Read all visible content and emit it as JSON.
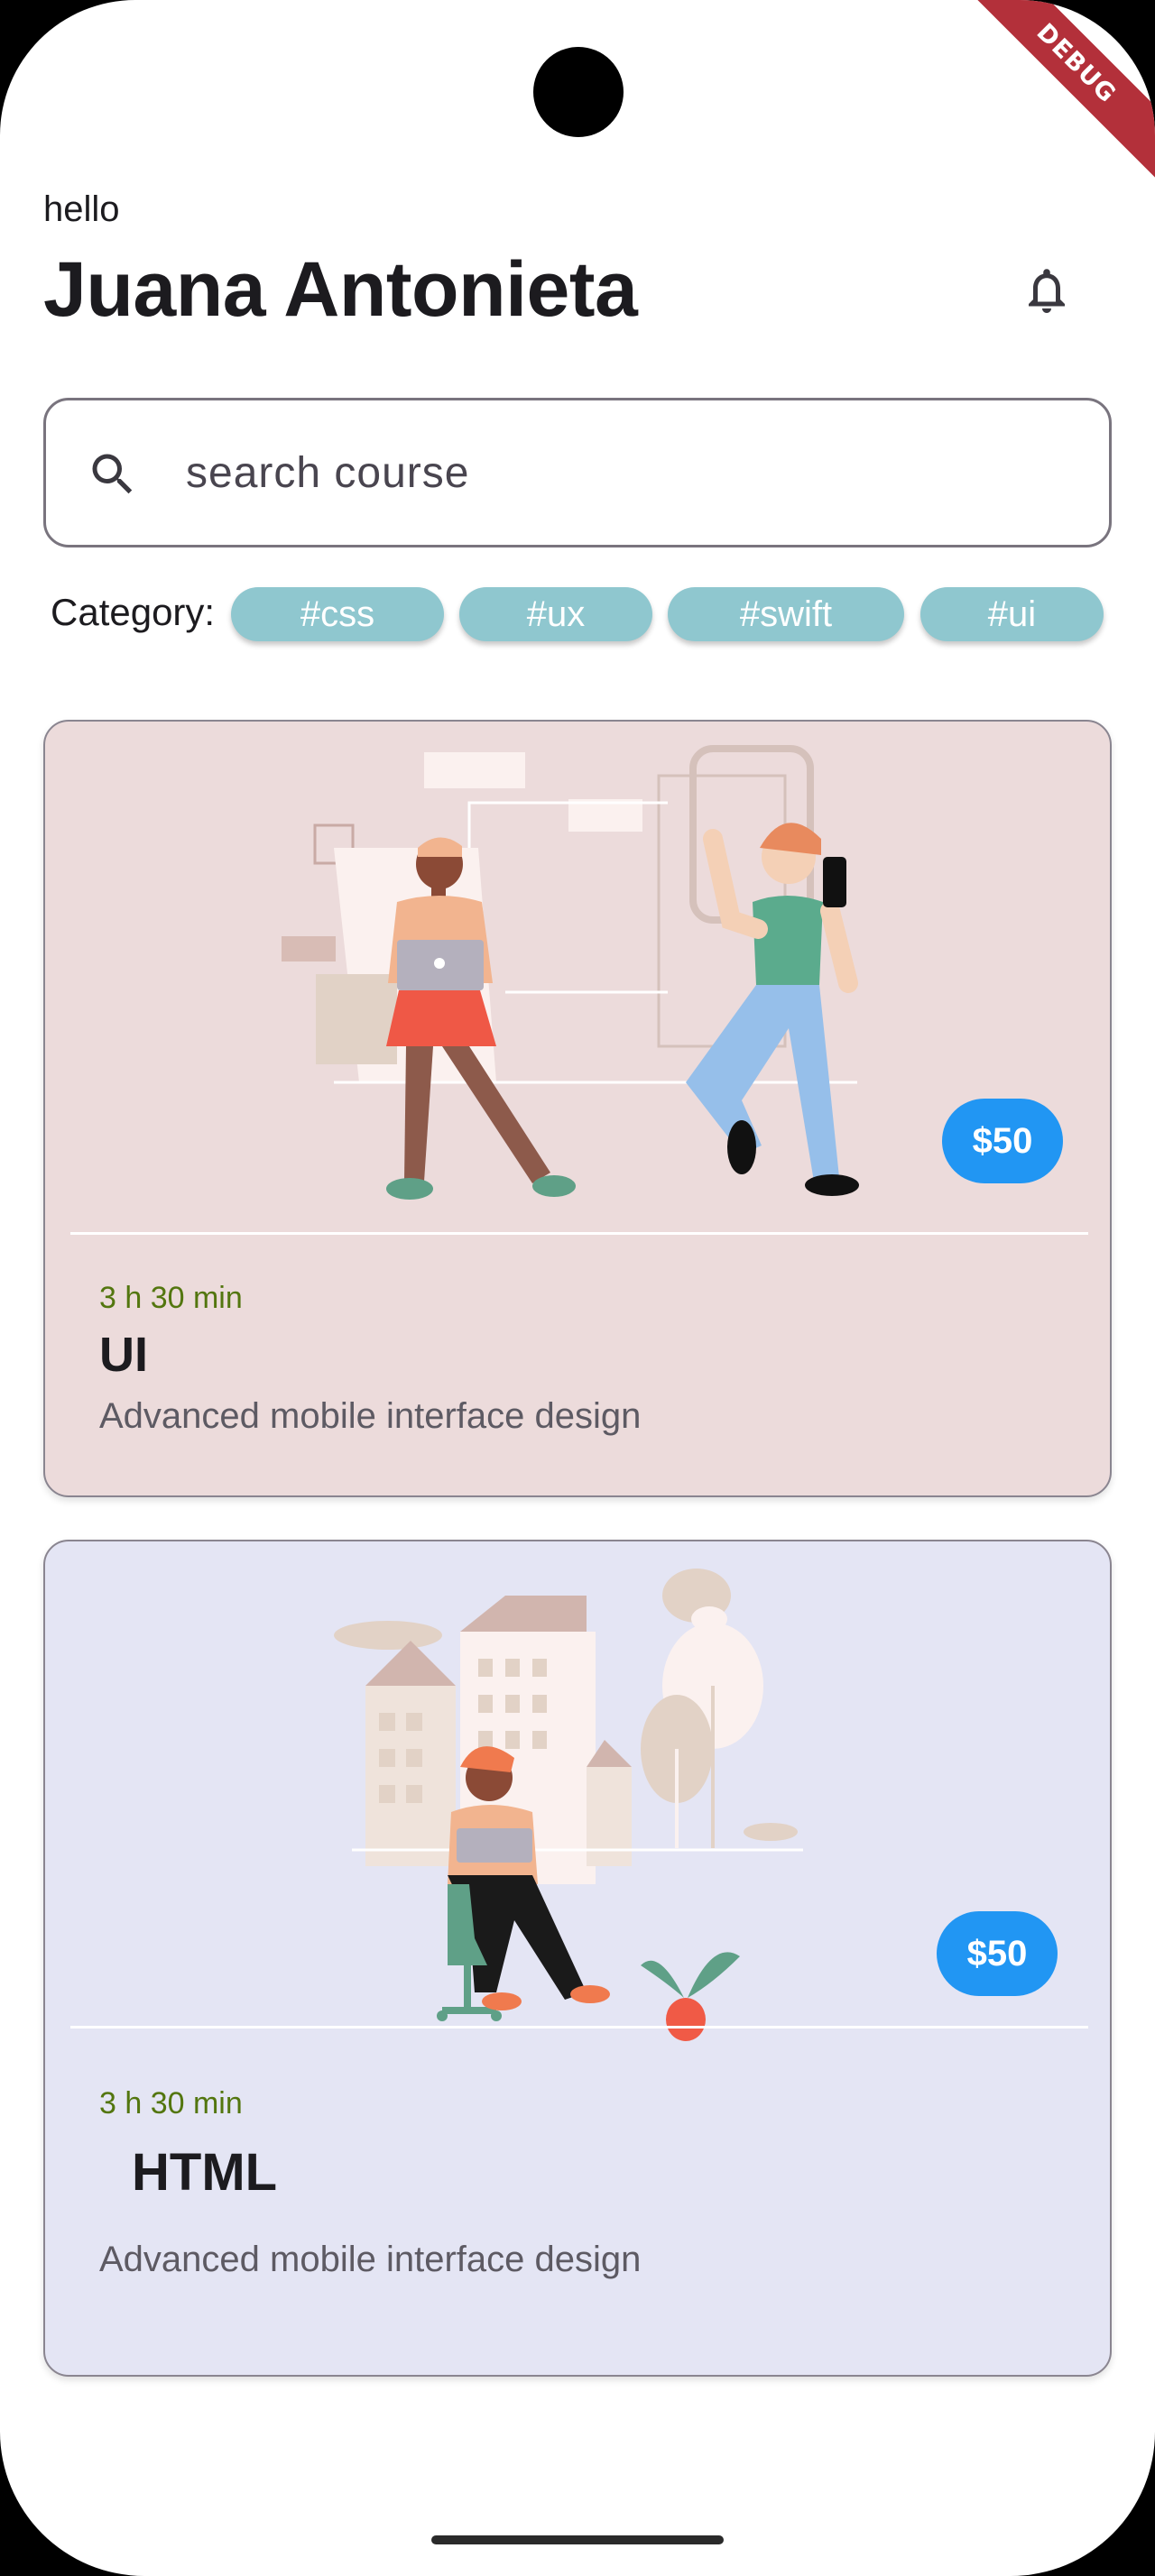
{
  "debug_banner": "DEBUG",
  "header": {
    "greeting": "hello",
    "user_name": "Juana Antonieta",
    "notification_icon": "bell-outline-icon"
  },
  "search": {
    "placeholder": "search course",
    "icon": "search-icon"
  },
  "categories": {
    "label": "Category:",
    "chips": [
      "#css",
      "#ux",
      "#swift",
      "#ui"
    ],
    "chip_color": "#8fc7cf"
  },
  "courses": [
    {
      "illustration": "two-people-with-laptop-and-phone-illustration",
      "price": "$50",
      "duration": "3 h 30 min",
      "title": "UI",
      "description": "Advanced mobile interface design",
      "background": "#ecdbdb"
    },
    {
      "illustration": "person-on-chair-with-laptop-city-illustration",
      "price": "$50",
      "duration": "3 h 30 min",
      "title": "HTML",
      "description": "Advanced mobile interface design",
      "background": "#e4e5f4"
    }
  ],
  "colors": {
    "accent_blue": "#2196f3",
    "duration_green": "#53760f"
  }
}
